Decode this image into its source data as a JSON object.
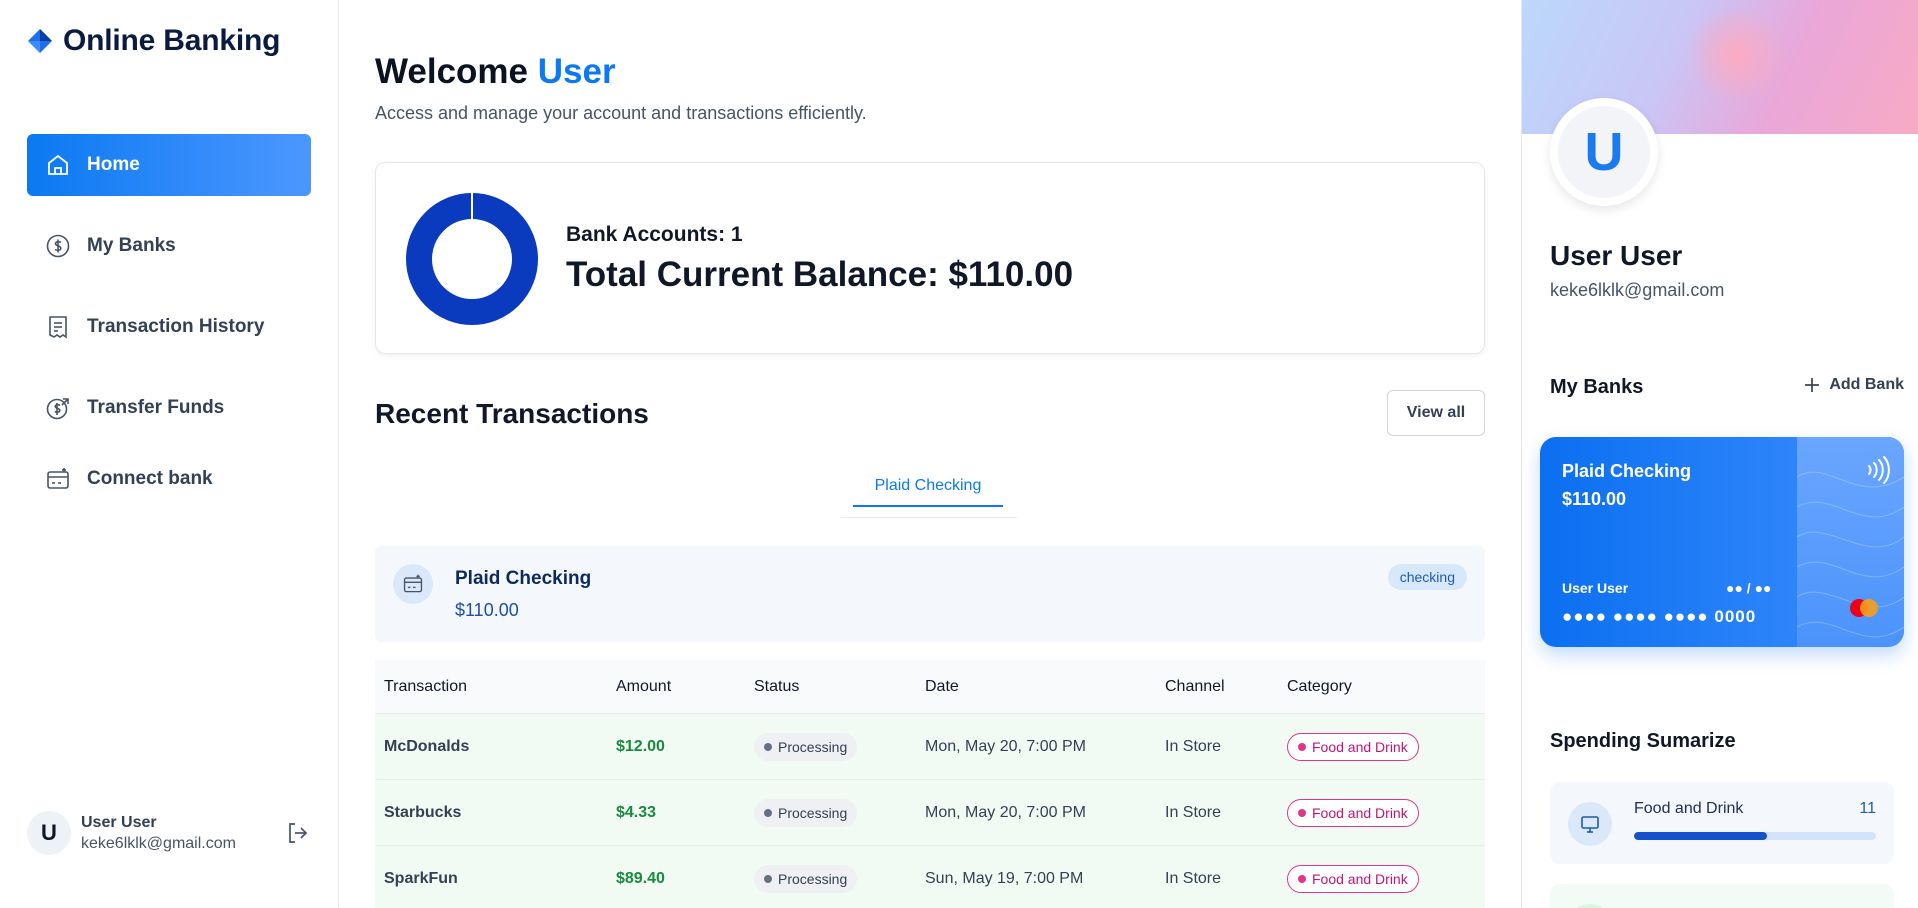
{
  "app": {
    "title": "Online Banking"
  },
  "sidebar": {
    "items": [
      {
        "label": "Home",
        "icon": "home-icon",
        "active": true
      },
      {
        "label": "My Banks",
        "icon": "dollar-circle-icon",
        "active": false
      },
      {
        "label": "Transaction History",
        "icon": "receipt-icon",
        "active": false
      },
      {
        "label": "Transfer Funds",
        "icon": "transfer-icon",
        "active": false
      },
      {
        "label": "Connect bank",
        "icon": "card-plus-icon",
        "active": false
      }
    ],
    "footer": {
      "avatar": "U",
      "name": "User User",
      "email": "keke6lklk@gmail.com"
    }
  },
  "main": {
    "welcome_prefix": "Welcome",
    "welcome_name": "User",
    "subtitle": "Access and manage your account and transactions efficiently.",
    "balance": {
      "accounts_text": "Bank Accounts: 1",
      "total_text": "Total Current Balance: $110.00",
      "donut_fraction": 1.0
    },
    "recent": {
      "title": "Recent Transactions",
      "view_all": "View all",
      "tab": "Plaid Checking",
      "account": {
        "name": "Plaid Checking",
        "balance": "$110.00",
        "type": "checking"
      },
      "columns": [
        "Transaction",
        "Amount",
        "Status",
        "Date",
        "Channel",
        "Category"
      ],
      "rows": [
        {
          "name": "McDonalds",
          "amount": "$12.00",
          "status": "Processing",
          "date": "Mon, May 20, 7:00 PM",
          "channel": "In Store",
          "category": "Food and Drink"
        },
        {
          "name": "Starbucks",
          "amount": "$4.33",
          "status": "Processing",
          "date": "Mon, May 20, 7:00 PM",
          "channel": "In Store",
          "category": "Food and Drink"
        },
        {
          "name": "SparkFun",
          "amount": "$89.40",
          "status": "Processing",
          "date": "Sun, May 19, 7:00 PM",
          "channel": "In Store",
          "category": "Food and Drink"
        }
      ]
    }
  },
  "right": {
    "avatar": "U",
    "name": "User User",
    "email": "keke6lklk@gmail.com",
    "my_banks_title": "My Banks",
    "add_bank": "Add Bank",
    "card": {
      "name": "Plaid Checking",
      "balance": "$110.00",
      "holder": "User User",
      "expiry": "●● / ●●",
      "number": "●●●● ●●●● ●●●● 0000"
    },
    "spending_title": "Spending Sumarize",
    "spending": [
      {
        "label": "Food and Drink",
        "count": "11",
        "fraction": 0.55
      }
    ]
  },
  "colors": {
    "accent": "#0b79f2",
    "donut": "#0a3bbf",
    "positive": "#1a8a3f",
    "category": "#e0368a"
  }
}
